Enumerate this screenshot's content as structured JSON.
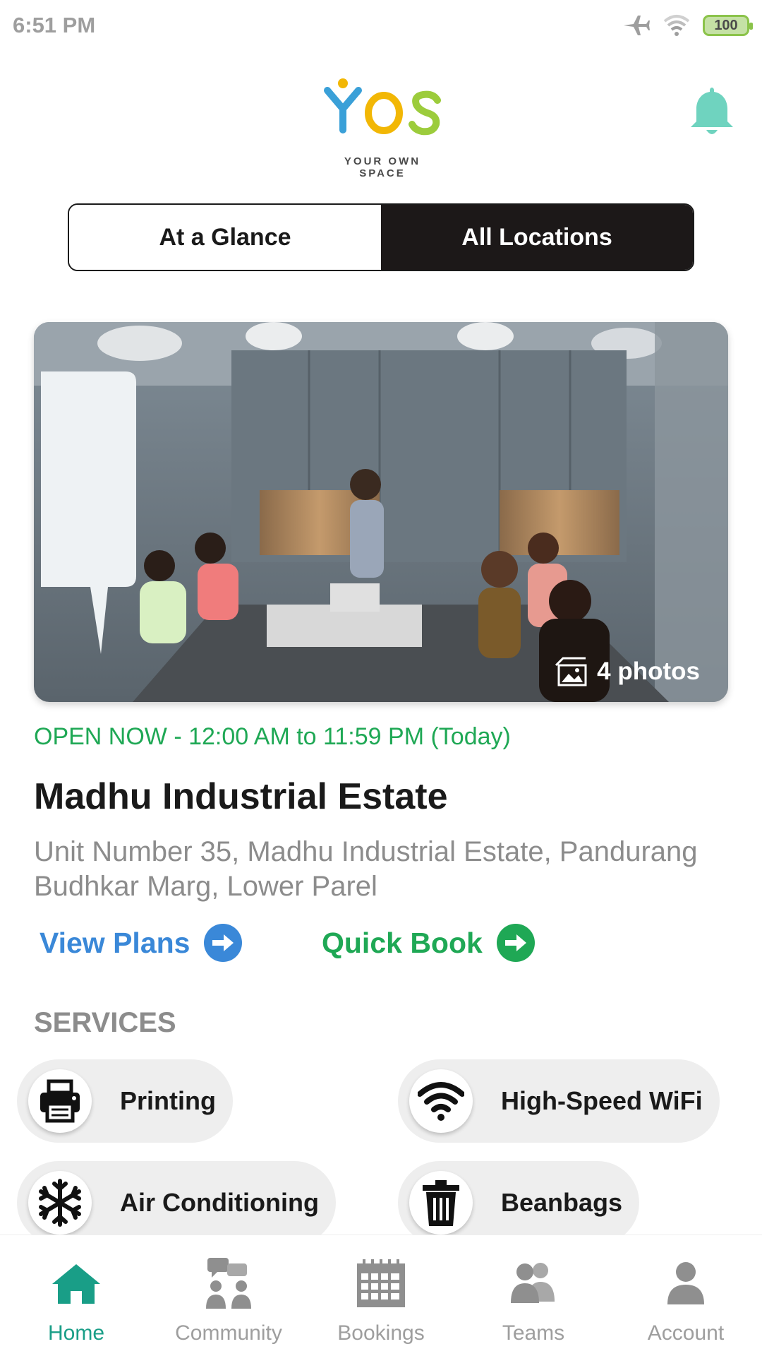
{
  "status_bar": {
    "time": "6:51 PM",
    "battery": "100"
  },
  "header": {
    "logo_text": "YOS",
    "logo_subtitle": "YOUR OWN SPACE"
  },
  "tabs": [
    {
      "label": "At a Glance",
      "active": false
    },
    {
      "label": "All Locations",
      "active": true
    }
  ],
  "location": {
    "photo_count_label": "4 photos",
    "open_status": "OPEN NOW - 12:00 AM to 11:59 PM (Today)",
    "name": "Madhu Industrial Estate",
    "address": "Unit Number 35, Madhu Industrial Estate, Pandurang Budhkar Marg, Lower Parel",
    "view_plans_label": "View Plans",
    "quick_book_label": "Quick Book"
  },
  "services": {
    "title": "SERVICES",
    "items": [
      {
        "label": "Printing",
        "icon": "printer-icon"
      },
      {
        "label": "High-Speed WiFi",
        "icon": "wifi-icon"
      },
      {
        "label": "Air Conditioning",
        "icon": "snowflake-icon"
      },
      {
        "label": "Beanbags",
        "icon": "trash-icon"
      }
    ]
  },
  "bottom_nav": [
    {
      "label": "Home",
      "icon": "home-icon",
      "active": true
    },
    {
      "label": "Community",
      "icon": "community-icon",
      "active": false
    },
    {
      "label": "Bookings",
      "icon": "calendar-icon",
      "active": false
    },
    {
      "label": "Teams",
      "icon": "teams-icon",
      "active": false
    },
    {
      "label": "Account",
      "icon": "account-icon",
      "active": false
    }
  ],
  "colors": {
    "accent_green": "#1fa855",
    "accent_blue": "#3a88d8",
    "nav_active": "#199e87",
    "bell": "#6fd3bf",
    "tab_active_bg": "#1c1818"
  }
}
